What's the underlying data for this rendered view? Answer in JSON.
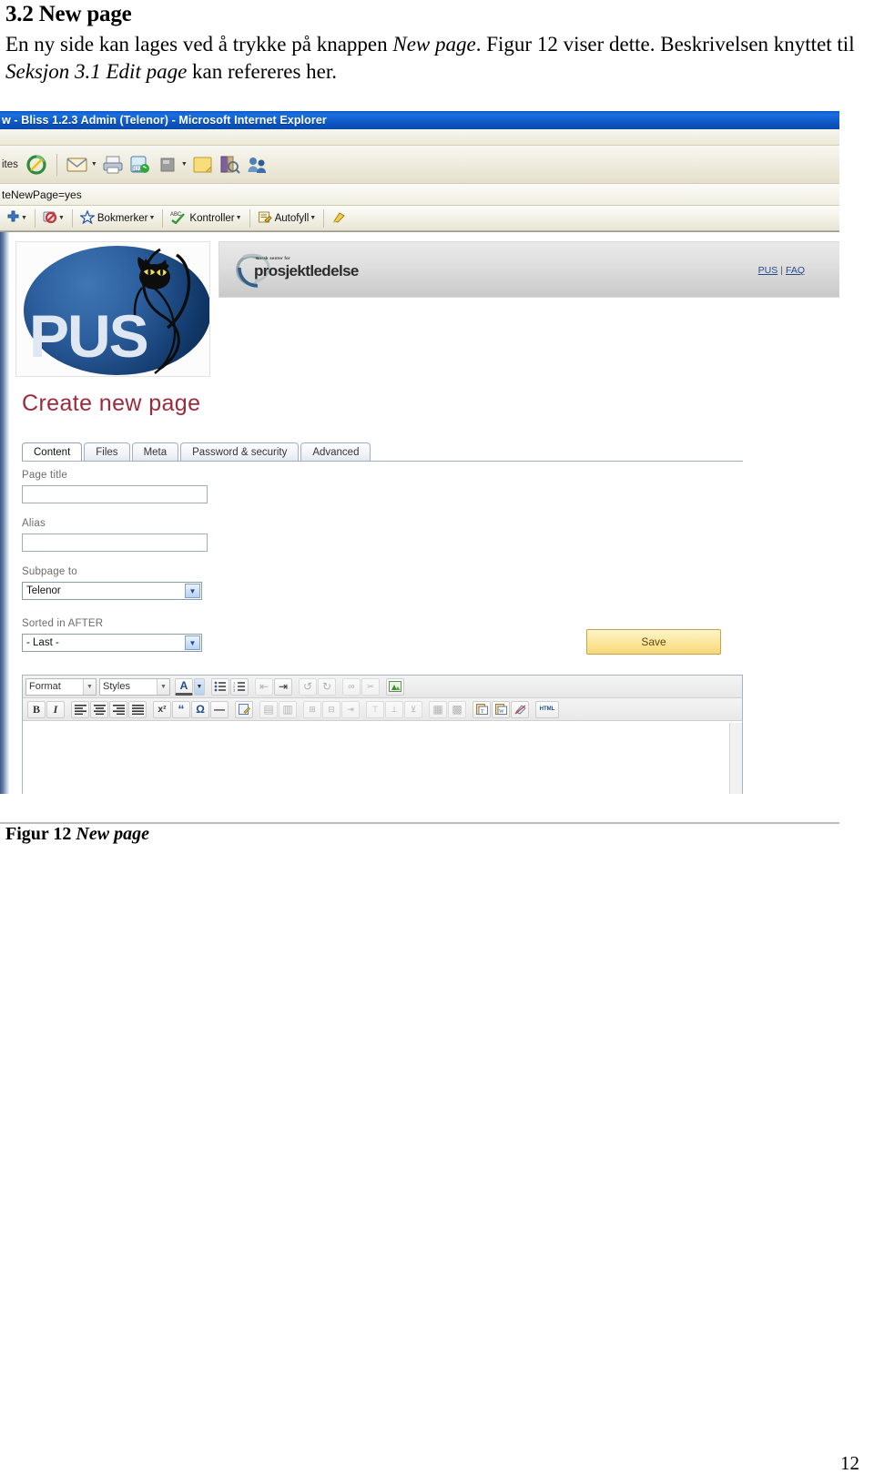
{
  "document": {
    "heading": "3.2 New page",
    "paragraph": {
      "part1": "En ny side kan lages ved å trykke på knappen ",
      "em1": "New page",
      "part2": ". Figur 12 viser dette. Beskrivelsen knyttet til ",
      "em2": "Seksjon 3.1 Edit page",
      "part3": " kan refereres her."
    },
    "caption": {
      "prefix": "Figur 12 ",
      "em": "New page"
    },
    "page_number": "12"
  },
  "browser": {
    "title": "w - Bliss 1.2.3 Admin (Telenor) - Microsoft Internet Explorer",
    "toolbar": {
      "favorites_label": "ites",
      "icons": [
        "refresh-icon",
        "mail-icon",
        "print-icon",
        "skype-call-icon",
        "edit-page-icon",
        "notes-icon",
        "research-icon",
        "messenger-icon"
      ]
    },
    "address_value": "teNewPage=yes",
    "google_toolbar": {
      "items": [
        {
          "label": "",
          "icon": "plus-icon"
        },
        {
          "label": "",
          "icon": "popup-blocker-icon"
        },
        {
          "label": "Bokmerker",
          "icon": "star-icon"
        },
        {
          "label": "Kontroller",
          "icon": "spellcheck-icon"
        },
        {
          "label": "Autofyll",
          "icon": "autofill-icon"
        },
        {
          "label": "",
          "icon": "highlighter-icon"
        }
      ]
    }
  },
  "site": {
    "logo_text": "PUS",
    "brand_small": "Norsk senter for",
    "brand_big": "prosjektledelse",
    "header_links": [
      {
        "label": "PUS"
      },
      {
        "label": "FAQ"
      }
    ],
    "link_separator": "|"
  },
  "page": {
    "title": "Create new page",
    "tabs": [
      {
        "label": "Content",
        "active": true
      },
      {
        "label": "Files",
        "active": false
      },
      {
        "label": "Meta",
        "active": false
      },
      {
        "label": "Password & security",
        "active": false
      },
      {
        "label": "Advanced",
        "active": false
      }
    ],
    "fields": [
      {
        "label": "Page title",
        "type": "text",
        "value": "",
        "placeholder": ""
      },
      {
        "label": "Alias",
        "type": "text",
        "value": "",
        "placeholder": ""
      },
      {
        "label": "Subpage to",
        "type": "select",
        "value": "Telenor"
      },
      {
        "label": "Sorted in AFTER",
        "type": "select",
        "value": "- Last -"
      }
    ],
    "save_label": "Save"
  },
  "editor": {
    "row1": {
      "format_label": "Format",
      "styles_label": "Styles",
      "buttons": [
        {
          "icon": "text-color-icon",
          "glyph": "A",
          "dim": false
        },
        {
          "icon": "color-dropdown-icon",
          "glyph": "▾",
          "dim": false
        },
        {
          "icon": "bulleted-list-icon",
          "glyph": "☰",
          "dim": false
        },
        {
          "icon": "numbered-list-icon",
          "glyph": "☰",
          "dim": false
        },
        {
          "icon": "outdent-icon",
          "glyph": "⇤",
          "dim": true
        },
        {
          "icon": "indent-icon",
          "glyph": "⇥",
          "dim": false
        },
        {
          "icon": "undo-icon",
          "glyph": "↺",
          "dim": true
        },
        {
          "icon": "redo-icon",
          "glyph": "↻",
          "dim": true
        },
        {
          "icon": "link-icon",
          "glyph": "∞",
          "dim": true
        },
        {
          "icon": "unlink-icon",
          "glyph": "✂",
          "dim": true
        },
        {
          "icon": "image-icon",
          "glyph": "🌲",
          "dim": false
        }
      ]
    },
    "row2": {
      "buttons": [
        {
          "icon": "bold-icon",
          "glyph": "B",
          "dim": false
        },
        {
          "icon": "italic-icon",
          "glyph": "I",
          "dim": false
        },
        {
          "icon": "align-left-icon",
          "glyph": "☰",
          "dim": false
        },
        {
          "icon": "align-center-icon",
          "glyph": "☰",
          "dim": false
        },
        {
          "icon": "align-right-icon",
          "glyph": "☰",
          "dim": false
        },
        {
          "icon": "align-justify-icon",
          "glyph": "☰",
          "dim": false
        },
        {
          "icon": "superscript-icon",
          "glyph": "x²",
          "dim": false
        },
        {
          "icon": "blockquote-icon",
          "glyph": "“",
          "dim": false
        },
        {
          "icon": "special-char-icon",
          "glyph": "Ω",
          "dim": false
        },
        {
          "icon": "horizontal-rule-icon",
          "glyph": "—",
          "dim": false
        },
        {
          "icon": "edit-source-icon",
          "glyph": "✎",
          "dim": false
        },
        {
          "icon": "insert-table-icon",
          "glyph": "▤",
          "dim": true
        },
        {
          "icon": "delete-table-icon",
          "glyph": "▥",
          "dim": true
        },
        {
          "icon": "insert-row-icon",
          "glyph": "⊞",
          "dim": true
        },
        {
          "icon": "delete-row-icon",
          "glyph": "⊟",
          "dim": true
        },
        {
          "icon": "merge-cells-icon",
          "glyph": "⇥",
          "dim": true
        },
        {
          "icon": "insert-column-icon",
          "glyph": "⊤",
          "dim": true
        },
        {
          "icon": "delete-column-icon",
          "glyph": "⊥",
          "dim": true
        },
        {
          "icon": "split-cell-icon",
          "glyph": "⊻",
          "dim": true
        },
        {
          "icon": "table-props-icon",
          "glyph": "▦",
          "dim": true
        },
        {
          "icon": "cell-props-icon",
          "glyph": "▩",
          "dim": true
        },
        {
          "icon": "paste-text-icon",
          "glyph": "T",
          "dim": false
        },
        {
          "icon": "paste-word-icon",
          "glyph": "W",
          "dim": false
        },
        {
          "icon": "remove-format-icon",
          "glyph": "⌫",
          "dim": false
        },
        {
          "icon": "html-source-icon",
          "glyph": "HTML",
          "dim": false
        }
      ]
    }
  }
}
